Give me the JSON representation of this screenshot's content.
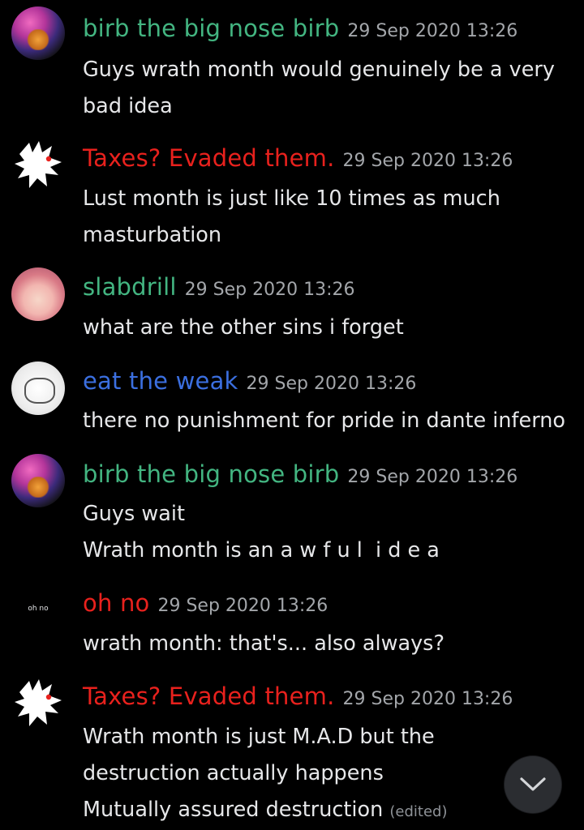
{
  "colors": {
    "green": "#43b581",
    "red": "#e8211d",
    "blue": "#3b6fe0",
    "timestamp": "#a3a6aa",
    "text": "#e6e7e9",
    "background": "#000000"
  },
  "messages": [
    {
      "author": "birb the big nose birb",
      "author_color": "#43b581",
      "avatar": "birb-avatar-icon",
      "timestamp": "29 Sep 2020 13:26",
      "lines": [
        "Guys wrath month would genuinely be a very",
        "bad idea"
      ]
    },
    {
      "author": "Taxes? Evaded them.",
      "author_color": "#e8211d",
      "avatar": "white-creature-avatar-icon",
      "timestamp": "29 Sep 2020 13:26",
      "lines": [
        "Lust month is just like 10 times as much",
        "masturbation"
      ]
    },
    {
      "author": "slabdrill",
      "author_color": "#43b581",
      "avatar": "anime-girl-avatar-icon",
      "timestamp": "29 Sep 2020 13:26",
      "lines": [
        "what are the other sins i forget"
      ]
    },
    {
      "author": "eat the weak",
      "author_color": "#3b6fe0",
      "avatar": "sketch-avatar-icon",
      "timestamp": "29 Sep 2020 13:26",
      "lines": [
        "there no punishment for pride in dante inferno"
      ]
    },
    {
      "author": "birb the big nose birb",
      "author_color": "#43b581",
      "avatar": "birb-avatar-icon",
      "timestamp": "29 Sep 2020 13:26",
      "lines": [
        "Guys wait",
        "Wrath month is an a w f u l  i d e a"
      ]
    },
    {
      "author": "oh no",
      "author_color": "#e8211d",
      "avatar_text": "oh no",
      "timestamp": "29 Sep 2020 13:26",
      "lines": [
        "wrath month: that's... also always?"
      ]
    },
    {
      "author": "Taxes? Evaded them.",
      "author_color": "#e8211d",
      "avatar": "white-creature-avatar-icon",
      "timestamp": "29 Sep 2020 13:26",
      "lines": [
        "Wrath month is just M.A.D but the",
        "destruction actually happens",
        "Mutually assured destruction"
      ],
      "edited_label": "(edited)"
    }
  ],
  "scroll_button": {
    "icon": "chevron-down-icon"
  }
}
